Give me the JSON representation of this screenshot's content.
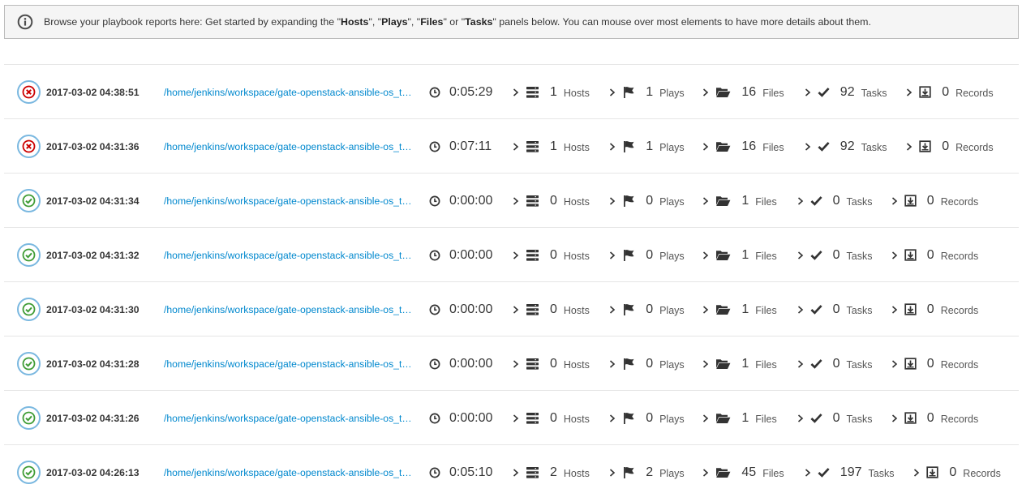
{
  "banner": {
    "prefix": "Browse your playbook reports here: Get started by expanding the \"",
    "hosts": "Hosts",
    "sep1": "\", \"",
    "plays": "Plays",
    "sep2": "\", \"",
    "files": "Files",
    "sep3": "\" or \"",
    "tasks": "Tasks",
    "suffix": "\" panels below. You can mouse over most elements to have more details about them."
  },
  "labels": {
    "hosts": "Hosts",
    "plays": "Plays",
    "files": "Files",
    "tasks": "Tasks",
    "records": "Records"
  },
  "colors": {
    "failed": "#cc0000",
    "ok": "#3f9c35",
    "link": "#0088ce"
  },
  "reports": [
    {
      "status": "failed",
      "date": "2017-03-02 04:38:51",
      "path": "/home/jenkins/workspace/gate-openstack-ansible-os_tempest-ansible-func-ubuntu-xenial/tests/test.yml",
      "duration": "0:05:29",
      "hosts": "1",
      "plays": "1",
      "files": "16",
      "tasks": "92",
      "records": "0"
    },
    {
      "status": "failed",
      "date": "2017-03-02 04:31:36",
      "path": "/home/jenkins/workspace/gate-openstack-ansible-os_tempest-ansible-func-ubuntu-xenial/tests/test.yml",
      "duration": "0:07:11",
      "hosts": "1",
      "plays": "1",
      "files": "16",
      "tasks": "92",
      "records": "0"
    },
    {
      "status": "ok",
      "date": "2017-03-02 04:31:34",
      "path": "/home/jenkins/workspace/gate-openstack-ansible-os_tempest-ansible-func-ubuntu-xenial/tests/test.yml",
      "duration": "0:00:00",
      "hosts": "0",
      "plays": "0",
      "files": "1",
      "tasks": "0",
      "records": "0"
    },
    {
      "status": "ok",
      "date": "2017-03-02 04:31:32",
      "path": "/home/jenkins/workspace/gate-openstack-ansible-os_tempest-ansible-func-ubuntu-xenial/tests/test.yml",
      "duration": "0:00:00",
      "hosts": "0",
      "plays": "0",
      "files": "1",
      "tasks": "0",
      "records": "0"
    },
    {
      "status": "ok",
      "date": "2017-03-02 04:31:30",
      "path": "/home/jenkins/workspace/gate-openstack-ansible-os_tempest-ansible-func-ubuntu-xenial/tests/test.yml",
      "duration": "0:00:00",
      "hosts": "0",
      "plays": "0",
      "files": "1",
      "tasks": "0",
      "records": "0"
    },
    {
      "status": "ok",
      "date": "2017-03-02 04:31:28",
      "path": "/home/jenkins/workspace/gate-openstack-ansible-os_tempest-ansible-func-ubuntu-xenial/tests/test.yml",
      "duration": "0:00:00",
      "hosts": "0",
      "plays": "0",
      "files": "1",
      "tasks": "0",
      "records": "0"
    },
    {
      "status": "ok",
      "date": "2017-03-02 04:31:26",
      "path": "/home/jenkins/workspace/gate-openstack-ansible-os_tempest-ansible-func-ubuntu-xenial/tests/test.yml",
      "duration": "0:00:00",
      "hosts": "0",
      "plays": "0",
      "files": "1",
      "tasks": "0",
      "records": "0"
    },
    {
      "status": "ok",
      "date": "2017-03-02 04:26:13",
      "path": "/home/jenkins/workspace/gate-openstack-ansible-os_tempest-ansible-func-ubuntu-xenial/tests/test.yml",
      "duration": "0:05:10",
      "hosts": "2",
      "plays": "2",
      "files": "45",
      "tasks": "197",
      "records": "0"
    }
  ]
}
